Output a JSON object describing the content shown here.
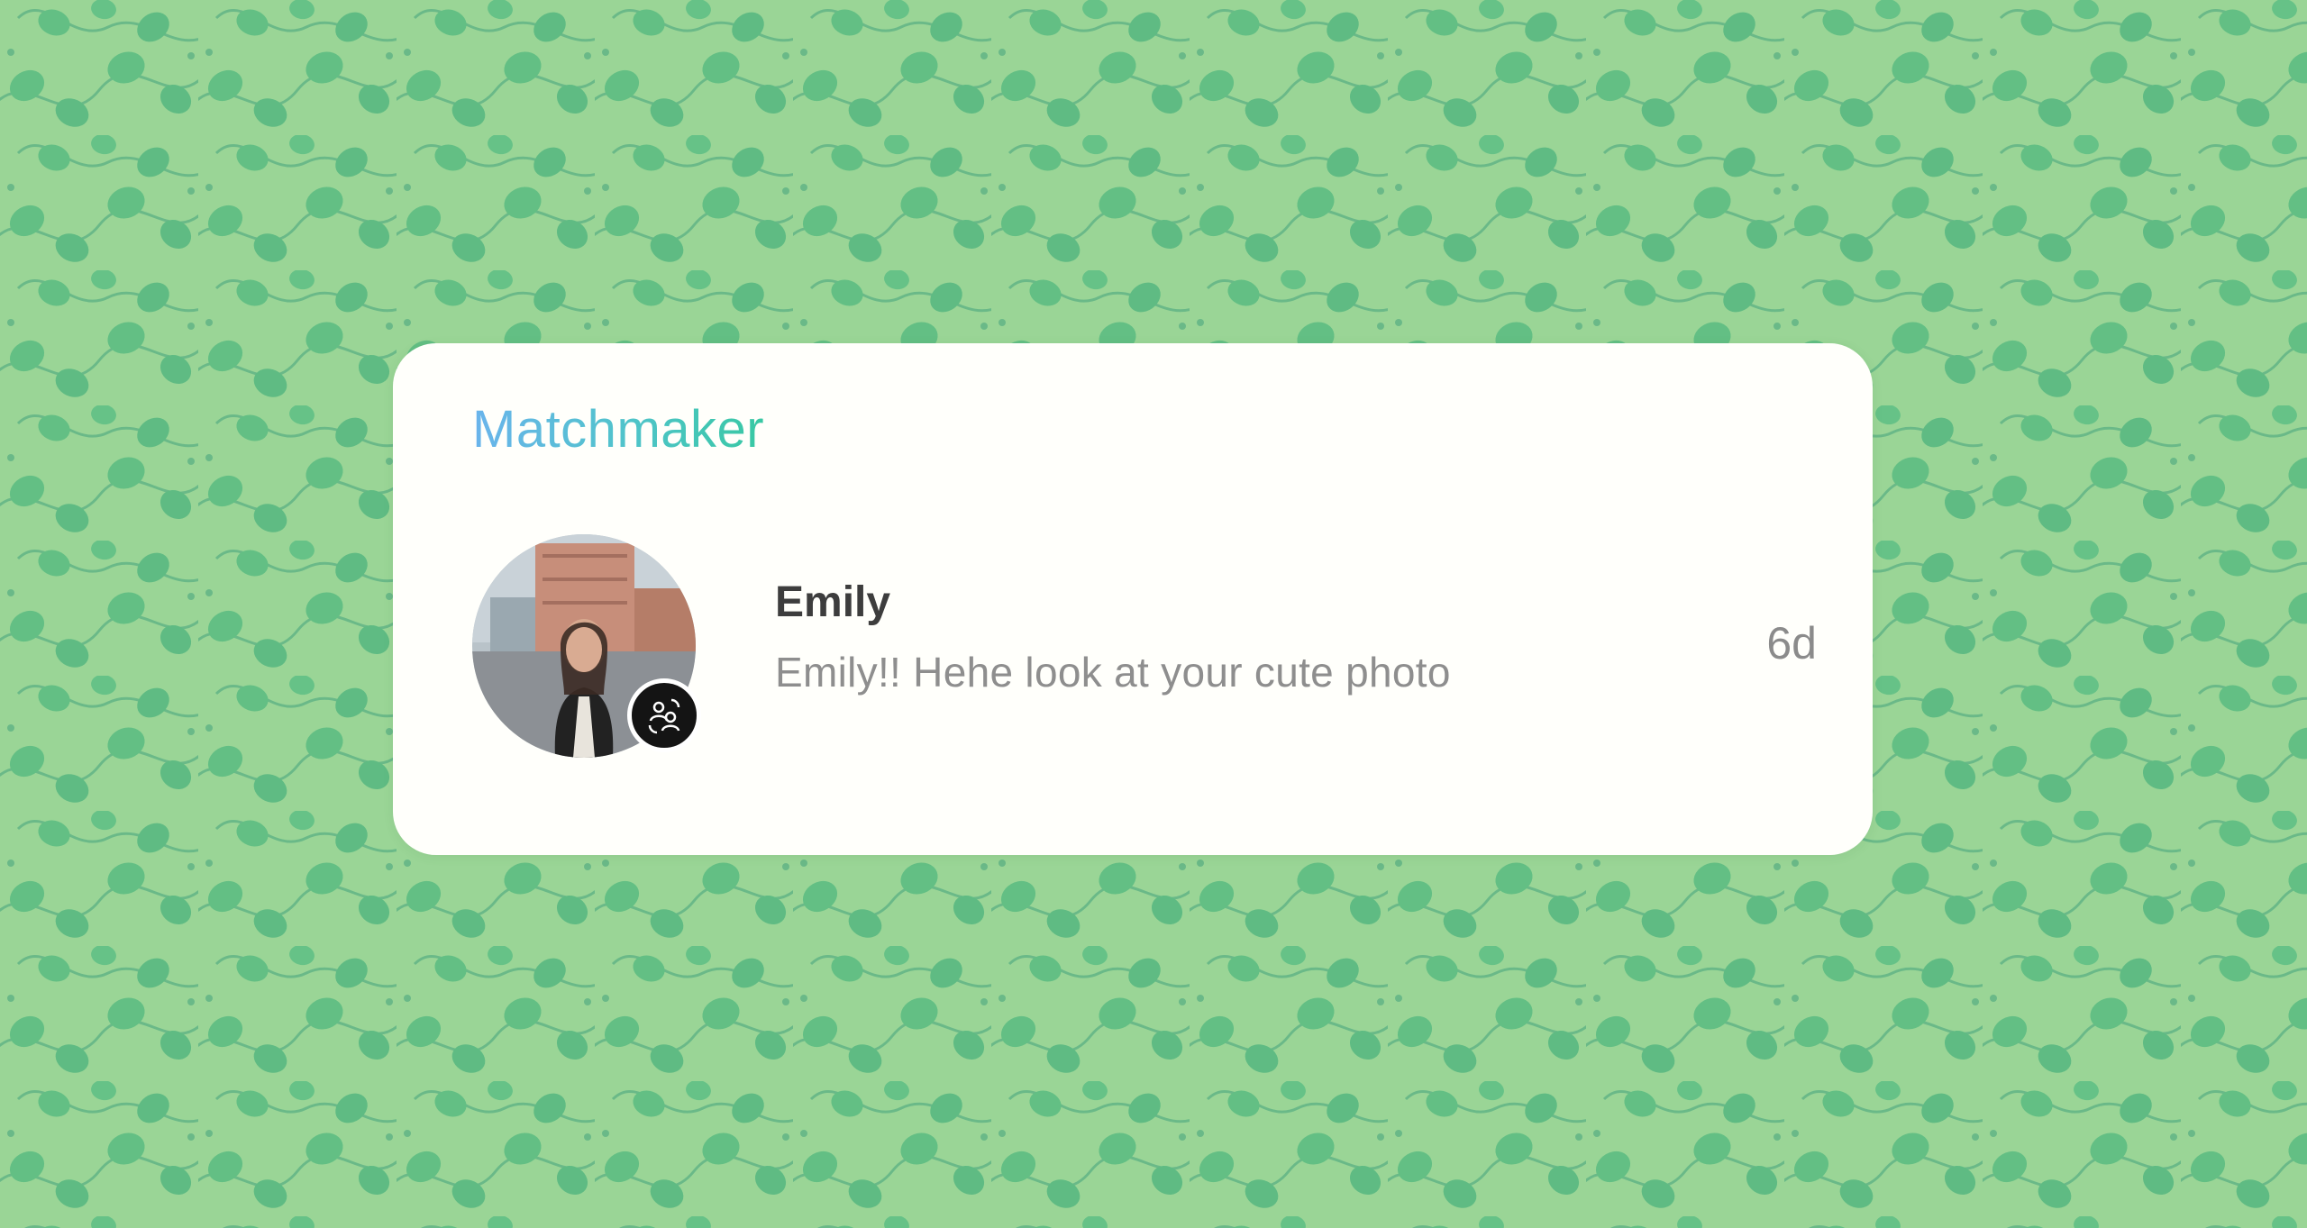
{
  "background": {
    "icon": "leaf-vine-pattern",
    "colors": {
      "base": "#8fd08f",
      "leaf": "#63bf84",
      "vine": "#6ab988"
    }
  },
  "card": {
    "title": "Matchmaker",
    "title_gradient": [
      "#6ab4ec",
      "#38c8a3"
    ],
    "chats": [
      {
        "name": "Emily",
        "preview": "Emily!! Hehe look at your cute photo",
        "time": "6d",
        "avatar_icon": "user-photo-avatar",
        "badge_icon": "matchmaker-badge-icon"
      }
    ]
  }
}
